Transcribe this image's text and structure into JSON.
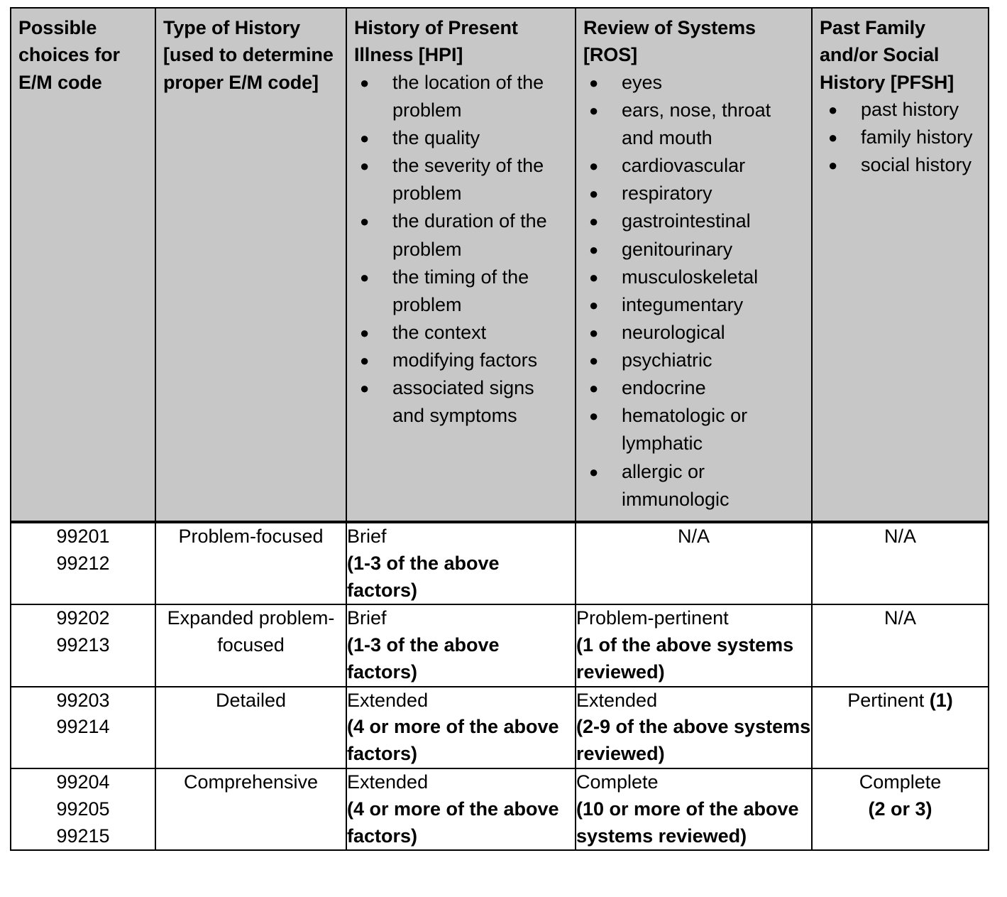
{
  "table": {
    "headers": [
      {
        "id": "possible-choices",
        "title": "Possible choices for E/M code",
        "items": []
      },
      {
        "id": "type-of-history",
        "title": "Type of History [used to determine proper E/M code]",
        "items": []
      },
      {
        "id": "hpi",
        "title": "History of Present Illness [HPI]",
        "items": [
          "the location of the problem",
          "the quality",
          "the severity of the problem",
          "the duration of the problem",
          "the timing of the problem",
          "the context",
          "modifying factors",
          "associated signs and symptoms"
        ]
      },
      {
        "id": "ros",
        "title": "Review of Systems [ROS]",
        "items": [
          "eyes",
          "ears, nose, throat and mouth",
          "cardiovascular",
          "respiratory",
          "gastrointestinal",
          "genitourinary",
          "musculoskeletal",
          "integumentary",
          "neurological",
          "psychiatric",
          "endocrine",
          "hematologic or lymphatic",
          "allergic or immunologic"
        ]
      },
      {
        "id": "pfsh",
        "title": "Past Family and/or Social History [PFSH]",
        "items": [
          "past history",
          "family history",
          "social history"
        ]
      }
    ],
    "rows": [
      {
        "codes": [
          "99201",
          "99212"
        ],
        "history_type": "Problem-focused",
        "hpi_plain": "Brief",
        "hpi_bold": "(1-3 of the above factors)",
        "ros_plain": "",
        "ros_bold": "",
        "ros_single": "N/A",
        "pfsh_plain": "N/A",
        "pfsh_bold": ""
      },
      {
        "codes": [
          "99202",
          "99213"
        ],
        "history_type": "Expanded problem-focused",
        "hpi_plain": "Brief",
        "hpi_bold": "(1-3 of the above factors)",
        "ros_plain": "Problem-pertinent",
        "ros_bold": "(1 of the above systems reviewed)",
        "ros_single": "",
        "pfsh_plain": "N/A",
        "pfsh_bold": ""
      },
      {
        "codes": [
          "99203",
          "99214"
        ],
        "history_type": "Detailed",
        "hpi_plain": "Extended",
        "hpi_bold": "(4 or more of the above factors)",
        "ros_plain": "Extended",
        "ros_bold": "(2-9 of the above systems reviewed)",
        "ros_single": "",
        "pfsh_plain": "Pertinent ",
        "pfsh_bold": "(1)"
      },
      {
        "codes": [
          "99204",
          "99205",
          "99215"
        ],
        "history_type": "Comprehensive",
        "hpi_plain": "Extended",
        "hpi_bold": "(4 or more of the above factors)",
        "ros_plain": "Complete",
        "ros_bold": "(10 or more of the above systems reviewed)",
        "ros_single": "",
        "pfsh_plain": "Complete",
        "pfsh_bold": "(2 or 3)"
      }
    ]
  },
  "colors": {
    "header_background": "#c7c7c7",
    "border": "#000000",
    "text": "#000000",
    "body_background": "#ffffff"
  }
}
